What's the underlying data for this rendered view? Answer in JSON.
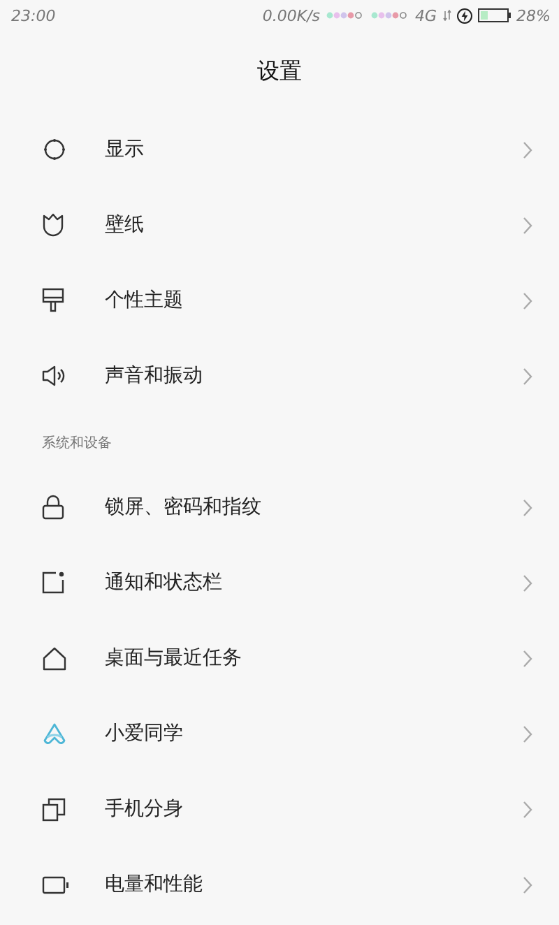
{
  "status_bar": {
    "time": "23:00",
    "speed": "0.00K/s",
    "network": "4G",
    "battery": "28%"
  },
  "title": "设置",
  "groups": [
    {
      "items": [
        {
          "label": "显示"
        },
        {
          "label": "壁纸"
        },
        {
          "label": "个性主题"
        },
        {
          "label": "声音和振动"
        }
      ]
    },
    {
      "header": "系统和设备",
      "items": [
        {
          "label": "锁屏、密码和指纹"
        },
        {
          "label": "通知和状态栏"
        },
        {
          "label": "桌面与最近任务"
        },
        {
          "label": "小爱同学"
        },
        {
          "label": "手机分身"
        },
        {
          "label": "电量和性能"
        }
      ]
    }
  ]
}
